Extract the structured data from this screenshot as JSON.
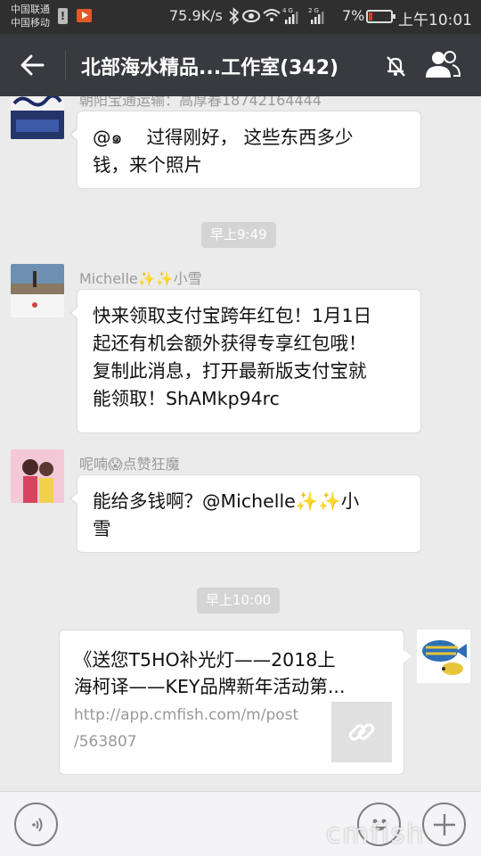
{
  "status_bar": {
    "carrier_1": "中国联通",
    "carrier_2": "中国移动",
    "speed": "75.9K/s",
    "signal_4g": "4G",
    "signal_2g": "2G",
    "battery": "7%",
    "time": "上午10:01"
  },
  "header": {
    "title": "北部海水精品...工作室(342)",
    "back_icon": "arrow-left-icon",
    "mute_icon": "bell-off-icon",
    "members_icon": "group-icon"
  },
  "chat": {
    "partial_sender": "朝阳宝通运输：高厚春18742164444",
    "messages": [
      {
        "type": "text",
        "lines": [
          "@๑　 过得刚好， 这些东西多少",
          "钱，来个照片"
        ]
      },
      {
        "type": "time",
        "text": "早上9:49"
      },
      {
        "type": "text",
        "sender": "Michelle✨✨小雪",
        "lines": [
          "快来领取支付宝跨年红包！1月1日",
          "起还有机会额外获得专享红包哦！",
          "复制此消息，打开最新版支付宝就",
          "能领取！ShAMkp94rc"
        ]
      },
      {
        "type": "text",
        "sender": "呢喃😱点赞狂魔",
        "lines": [
          "能给多钱啊？@Michelle✨✨小",
          "雪"
        ]
      },
      {
        "type": "time",
        "text": "早上10:00"
      },
      {
        "type": "link",
        "title_lines": [
          "《送您T5HO补光灯——2018上",
          "海柯译——KEY品牌新年活动第..."
        ],
        "url_lines": [
          "http://app.cmfish.com/m/post",
          "/563807"
        ],
        "thumb_icon": "link-icon"
      }
    ]
  },
  "input_bar": {
    "voice_icon": "voice-icon",
    "emoji_icon": "emoji-icon",
    "plus_icon": "plus-icon"
  },
  "watermark": "cmfish",
  "colors": {
    "statusbar": "#2f2f2f",
    "titlebar": "#393a3f",
    "chat_bg": "#ebebeb",
    "bubble": "#ffffff",
    "timestamp_bg": "#d4d4d4"
  }
}
